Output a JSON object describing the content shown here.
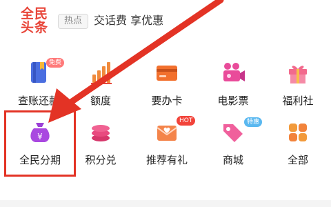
{
  "header": {
    "logo_line1": "全民",
    "logo_line2": "头条",
    "hot_tag": "热点",
    "headline": "交话费 享优惠"
  },
  "grid": {
    "row1": [
      {
        "label": "查账还款",
        "icon": "bill-book-icon",
        "badge": "免费"
      },
      {
        "label": "额度",
        "icon": "bar-chart-icon"
      },
      {
        "label": "要办卡",
        "icon": "card-icon"
      },
      {
        "label": "电影票",
        "icon": "movie-camera-icon"
      },
      {
        "label": "福利社",
        "icon": "gift-icon"
      }
    ],
    "row2": [
      {
        "label": "全民分期",
        "icon": "money-bag-icon"
      },
      {
        "label": "积分兑",
        "icon": "coin-stack-icon"
      },
      {
        "label": "推荐有礼",
        "icon": "envelope-gift-icon",
        "badge": "HOT"
      },
      {
        "label": "商城",
        "icon": "price-tag-icon",
        "badge": "特惠"
      },
      {
        "label": "全部",
        "icon": "all-squares-icon"
      }
    ]
  },
  "colors": {
    "brand_red": "#e8463a",
    "annotation_red": "#e33325"
  }
}
